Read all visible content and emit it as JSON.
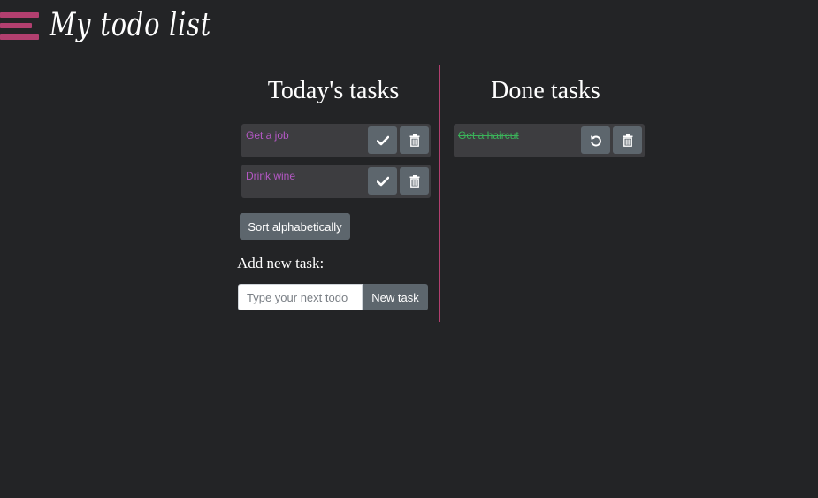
{
  "header": {
    "title": "My todo list",
    "menu_icon": "hamburger-menu-icon",
    "accent_color": "#b23f6f"
  },
  "today": {
    "heading": "Today's tasks",
    "tasks": [
      {
        "label": "Get a job",
        "icons": [
          "check-icon",
          "trash-icon"
        ]
      },
      {
        "label": "Drink wine",
        "icons": [
          "check-icon",
          "trash-icon"
        ]
      }
    ],
    "sort_label": "Sort alphabetically"
  },
  "add_task": {
    "label": "Add new task:",
    "placeholder": "Type your next todo",
    "value": "",
    "button_label": "New task"
  },
  "done": {
    "heading": "Done tasks",
    "tasks": [
      {
        "label": "Get a haircut",
        "icons": [
          "undo-icon",
          "trash-icon"
        ]
      }
    ]
  },
  "colors": {
    "background": "#232426",
    "card": "#3d3d40",
    "button": "#5d666d",
    "todo_text": "#b458c4",
    "done_text": "#3bb35a"
  }
}
